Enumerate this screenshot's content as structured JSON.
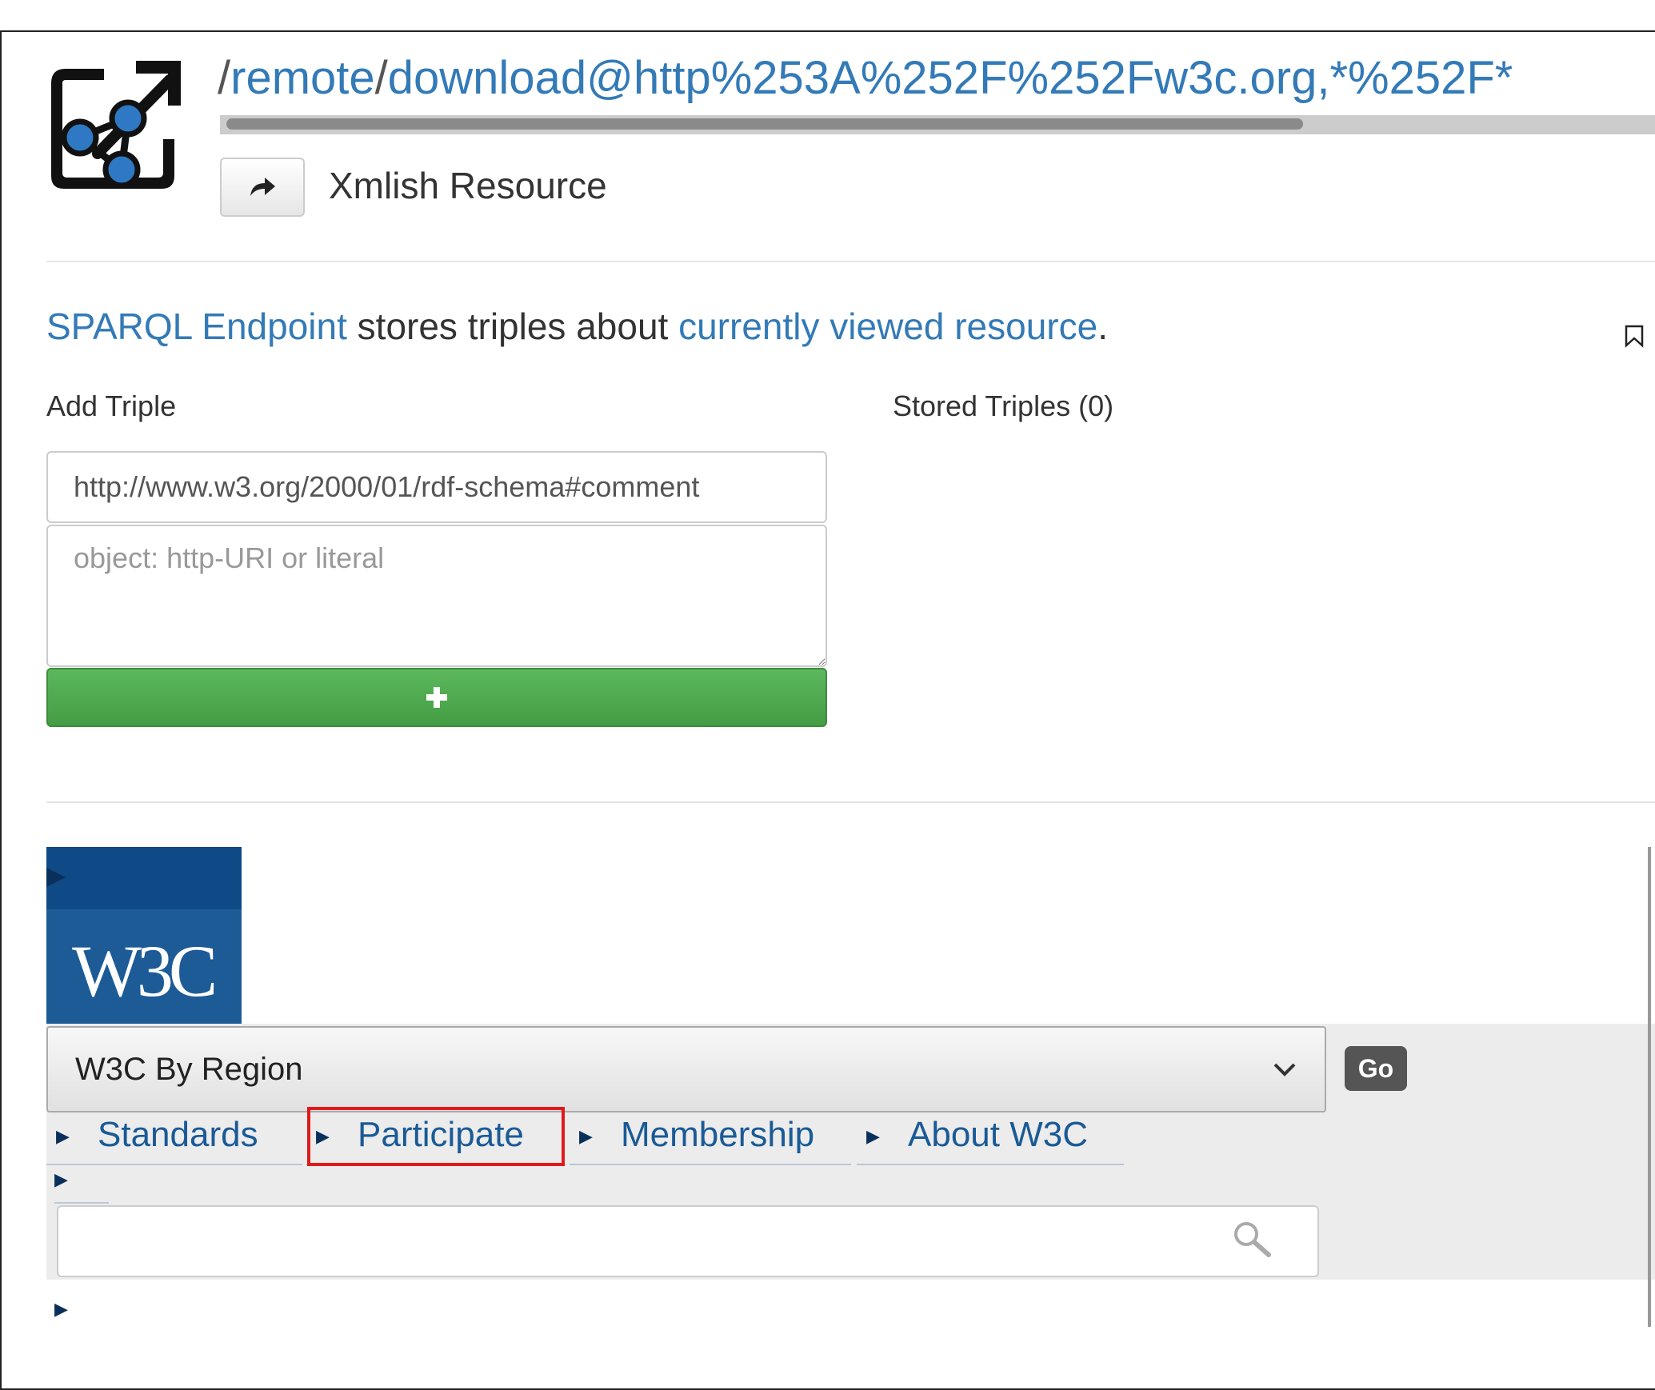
{
  "header": {
    "path_slash": "/",
    "path_remote": "remote",
    "path_sep": "/",
    "path_rest": "download@http%253A%252F%252Fw3c.org,*%252F*",
    "type_label": "Xmlish Resource"
  },
  "sparql": {
    "endpoint_link": "SPARQL Endpoint",
    "middle_text": " stores triples about ",
    "resource_link": "currently viewed resource",
    "period": "."
  },
  "triples": {
    "add_label": "Add Triple",
    "stored_label": "Stored Triples (0)",
    "predicate_value": "http://www.w3.org/2000/01/rdf-schema#comment",
    "object_placeholder": "object: http-URI or literal",
    "add_button": "+"
  },
  "w3c": {
    "logo_text": "W3C",
    "region_select": "W3C By Region",
    "go_button": "Go",
    "nav": [
      "Standards",
      "Participate",
      "Membership",
      "About W3C"
    ]
  },
  "colors": {
    "link": "#337ab7",
    "success": "#5cb85c",
    "highlight": "#e01a1a",
    "w3c_blue": "#1d5b97"
  }
}
